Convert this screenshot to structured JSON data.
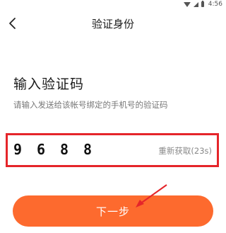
{
  "status_bar": {
    "time": "4:56",
    "icons": [
      "wifi-icon",
      "signal-icon",
      "battery-icon"
    ]
  },
  "nav": {
    "title": "验证身份",
    "back_icon": "chevron-left-icon"
  },
  "main": {
    "heading": "输入验证码",
    "description": "请输入发送给该帐号绑定的手机号的验证码",
    "code_digits": [
      "9",
      "6",
      "8",
      "8"
    ],
    "resend_label": "重新获取(23s)",
    "next_button_label": "下一步"
  },
  "colors": {
    "accent": "#fd6a2e",
    "highlight_border": "#e5252a",
    "annotation_arrow": "#e5252a"
  }
}
